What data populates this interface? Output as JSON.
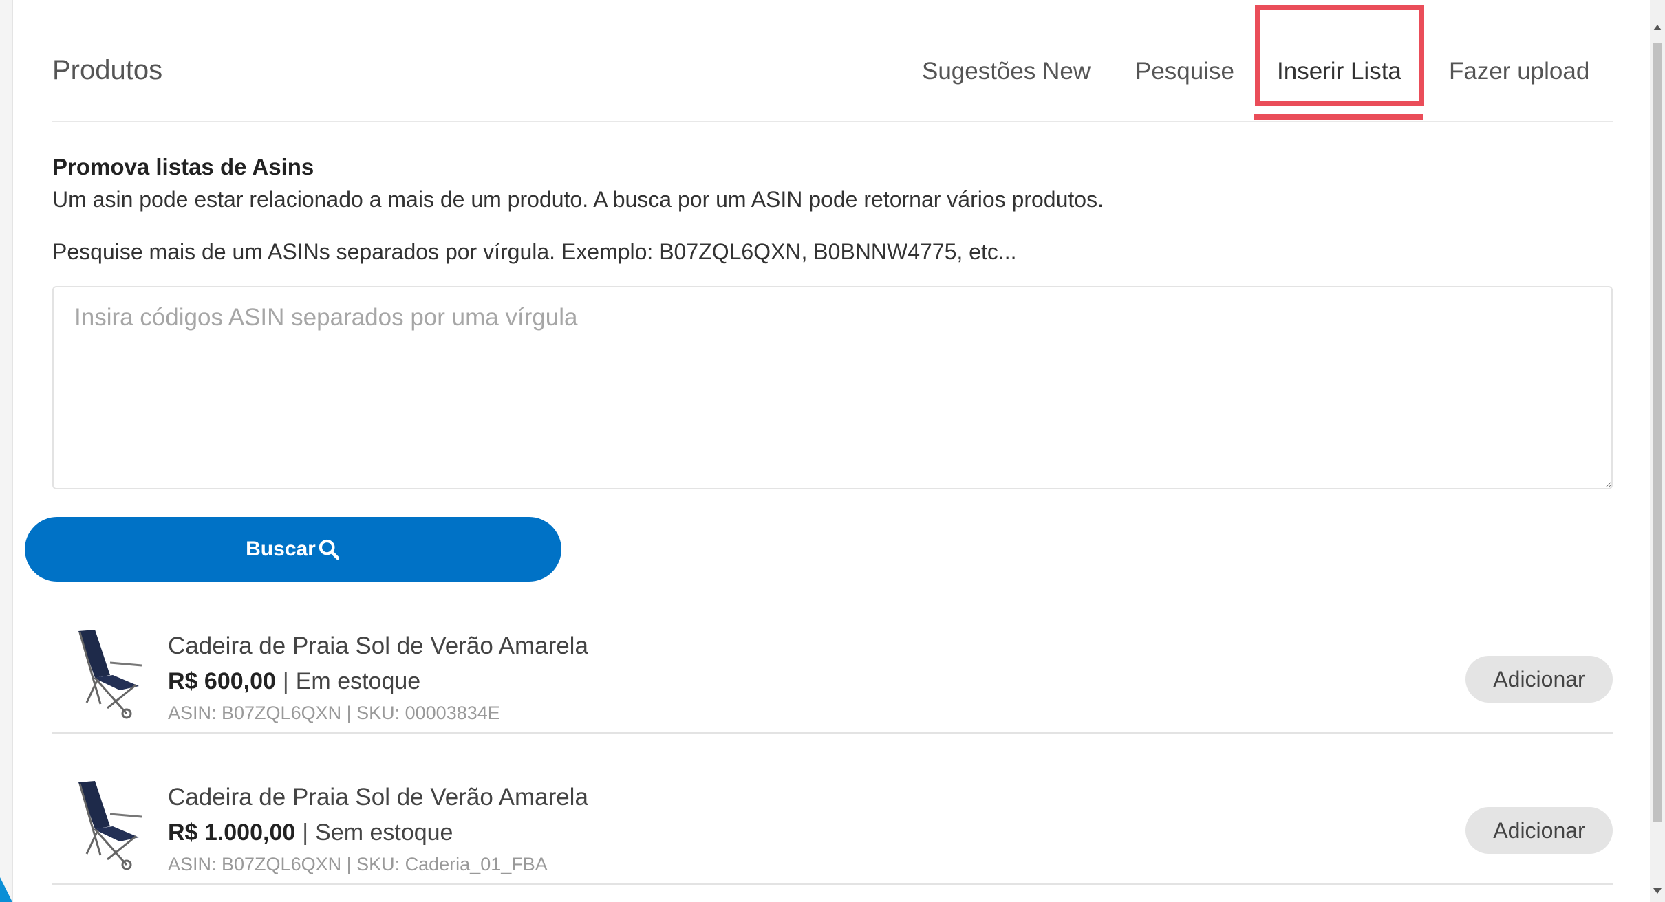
{
  "header": {
    "title": "Produtos",
    "tabs": [
      {
        "label": "Sugestões New"
      },
      {
        "label": "Pesquise"
      },
      {
        "label": "Inserir Lista"
      },
      {
        "label": "Fazer upload"
      }
    ],
    "active_tab": "Inserir Lista",
    "accent_color": "#ea4d59"
  },
  "section": {
    "title": "Promova listas de Asins",
    "description": "Um asin pode estar relacionado a mais de um produto. A busca por um ASIN pode retornar vários produtos.",
    "instructions": "Pesquise mais de um ASINs separados por vírgula. Exemplo: B07ZQL6QXN, B0BNNW4775, etc...",
    "input_placeholder": "Insira códigos ASIN separados por uma vírgula",
    "search_label": "Buscar",
    "search_color": "#0072c6"
  },
  "products": [
    {
      "name": "Cadeira de Praia Sol de Verão Amarela",
      "price": "R$ 600,00",
      "stock": "Em estoque",
      "meta": "ASIN: B07ZQL6QXN | SKU: 00003834E",
      "add_label": "Adicionar",
      "icon": "beach-chair-icon"
    },
    {
      "name": "Cadeira de Praia Sol de Verão Amarela",
      "price": "R$ 1.000,00",
      "stock": "Sem estoque",
      "meta": "ASIN: B07ZQL6QXN | SKU: Caderia_01_FBA",
      "add_label": "Adicionar",
      "icon": "beach-chair-icon"
    }
  ]
}
